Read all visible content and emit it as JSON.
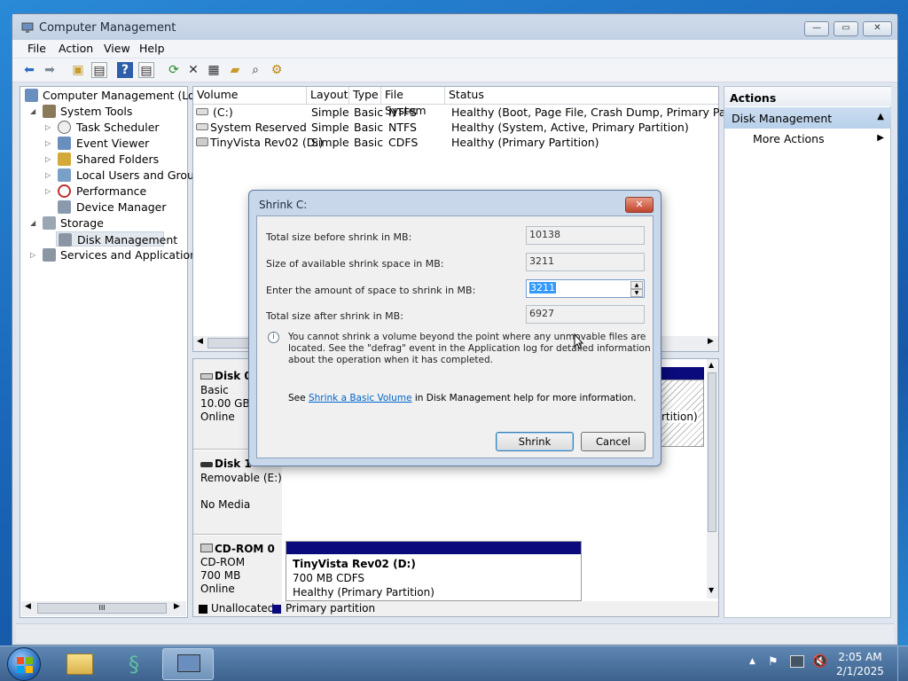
{
  "window": {
    "title": "Computer Management",
    "menu": [
      "File",
      "Action",
      "View",
      "Help"
    ]
  },
  "tree": {
    "root": "Computer Management (Local",
    "system_tools": "System Tools",
    "task_scheduler": "Task Scheduler",
    "event_viewer": "Event Viewer",
    "shared_folders": "Shared Folders",
    "local_users": "Local Users and Groups",
    "performance": "Performance",
    "device_manager": "Device Manager",
    "storage": "Storage",
    "disk_management": "Disk Management",
    "services": "Services and Applications"
  },
  "volume_table": {
    "headers": [
      "Volume",
      "Layout",
      "Type",
      "File System",
      "Status"
    ],
    "rows": [
      {
        "volume": "(C:)",
        "layout": "Simple",
        "type": "Basic",
        "fs": "NTFS",
        "status": "Healthy (Boot, Page File, Crash Dump, Primary Partition)"
      },
      {
        "volume": "System Reserved",
        "layout": "Simple",
        "type": "Basic",
        "fs": "NTFS",
        "status": "Healthy (System, Active, Primary Partition)"
      },
      {
        "volume": "TinyVista Rev02 (D:)",
        "layout": "Simple",
        "type": "Basic",
        "fs": "CDFS",
        "status": "Healthy (Primary Partition)"
      }
    ]
  },
  "disks": {
    "disk0": {
      "name": "Disk 0",
      "type": "Basic",
      "size": "10.00 GB",
      "state": "Online",
      "partial": "rtition)"
    },
    "disk1": {
      "name": "Disk 1",
      "type": "Removable (E:)",
      "state": "No Media"
    },
    "cdrom0": {
      "name": "CD-ROM 0",
      "type": "CD-ROM",
      "size": "700 MB",
      "state": "Online",
      "volume_label": "TinyVista Rev02  (D:)",
      "volume_size": "700 MB CDFS",
      "volume_status": "Healthy (Primary Partition)"
    }
  },
  "legend": {
    "unallocated": "Unallocated",
    "primary": "Primary partition"
  },
  "actions": {
    "header": "Actions",
    "section": "Disk Management",
    "more": "More Actions"
  },
  "dialog": {
    "title": "Shrink C:",
    "total_before_label": "Total size before shrink in MB:",
    "total_before_value": "10138",
    "available_label": "Size of available shrink space in MB:",
    "available_value": "3211",
    "enter_label": "Enter the amount of space to shrink in MB:",
    "enter_value": "3211",
    "total_after_label": "Total size after shrink in MB:",
    "total_after_value": "6927",
    "info_text": "You cannot shrink a volume beyond the point where any unmovable files are located. See the \"defrag\" event in the Application log for detailed information about the operation when it has completed.",
    "see_prefix": "See ",
    "see_link": "Shrink a Basic Volume",
    "see_suffix": " in Disk Management help for more information.",
    "shrink_button": "Shrink",
    "cancel_button": "Cancel"
  },
  "taskbar": {
    "time": "2:05 AM",
    "date": "2/1/2025"
  },
  "scrollbar_thumb": "III"
}
